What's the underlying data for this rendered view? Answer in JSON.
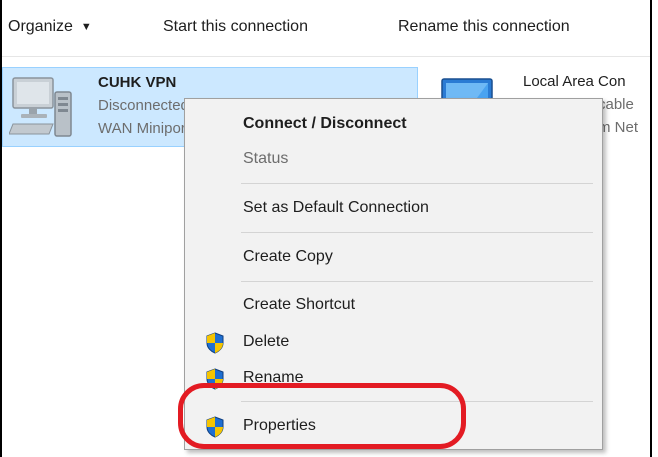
{
  "toolbar": {
    "organize_label": "Organize",
    "organize_caret": "▼",
    "start_label": "Start this connection",
    "rename_label": "Rename this connection"
  },
  "connections": [
    {
      "name": "CUHK VPN",
      "line1": "Disconnected",
      "line2": "WAN Miniport (PPTP)",
      "icon": "computer-network-icon",
      "selected": true
    },
    {
      "name": "Local Area Con",
      "line1": "cable",
      "line2": "m Net",
      "icon": "network-adapter-icon",
      "selected": false
    }
  ],
  "context_menu": {
    "items": [
      {
        "label": "Connect / Disconnect",
        "bold": true,
        "disabled": false,
        "shield": false
      },
      {
        "label": "Status",
        "bold": false,
        "disabled": true,
        "shield": false
      },
      {
        "label": "Set as Default Connection",
        "bold": false,
        "disabled": false,
        "shield": false
      },
      {
        "label": "Create Copy",
        "bold": false,
        "disabled": false,
        "shield": false
      },
      {
        "label": "Create Shortcut",
        "bold": false,
        "disabled": false,
        "shield": true
      },
      {
        "label": "Delete",
        "bold": false,
        "disabled": false,
        "shield": true
      },
      {
        "label": "Rename",
        "bold": false,
        "disabled": false,
        "shield": true
      },
      {
        "label": "Properties",
        "bold": false,
        "disabled": false,
        "shield": true
      }
    ]
  },
  "colors": {
    "selection_bg": "#cce8ff",
    "menu_bg": "#f2f2f2",
    "annotation": "#e31b23",
    "shield_blue": "#1f6fd1",
    "shield_yellow": "#f5c400"
  }
}
